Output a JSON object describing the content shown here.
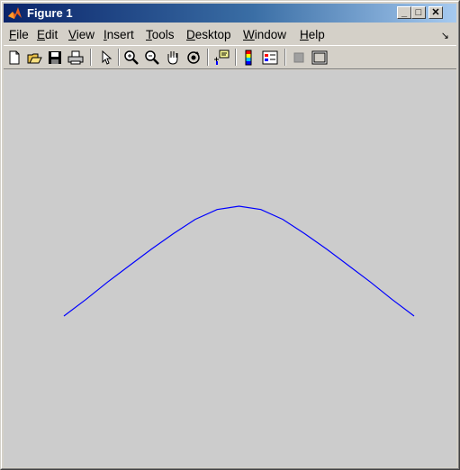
{
  "window": {
    "title": "Figure 1",
    "controls": {
      "minimize": "_",
      "maximize": "□",
      "close": "✕"
    }
  },
  "menu": {
    "items": [
      {
        "label": "File",
        "key": "F",
        "rest": "ile"
      },
      {
        "label": "Edit",
        "key": "E",
        "rest": "dit"
      },
      {
        "label": "View",
        "key": "V",
        "rest": "iew"
      },
      {
        "label": "Insert",
        "key": "I",
        "rest": "nsert"
      },
      {
        "label": "Tools",
        "key": "T",
        "rest": "ools"
      },
      {
        "label": "Desktop",
        "key": "D",
        "rest": "esktop"
      },
      {
        "label": "Window",
        "key": "W",
        "rest": "indow"
      },
      {
        "label": "Help",
        "key": "H",
        "rest": "elp"
      }
    ],
    "dock_arrow": "↘"
  },
  "toolbar": {
    "icons": [
      "new-figure-icon",
      "open-file-icon",
      "save-icon",
      "print-icon",
      "edit-plot-arrow-icon",
      "zoom-in-icon",
      "zoom-out-icon",
      "pan-hand-icon",
      "rotate-3d-icon",
      "data-cursor-icon",
      "colorbar-icon",
      "legend-icon",
      "hide-plot-tools-icon",
      "show-plot-tools-icon"
    ]
  },
  "colors": {
    "curve": "#0000ff",
    "background": "#cccccc",
    "title_start": "#0a246a",
    "title_end": "#a6caf0"
  },
  "chart_data": {
    "type": "line",
    "title": "",
    "xlabel": "",
    "ylabel": "",
    "axes_visible": false,
    "grid": false,
    "series": [
      {
        "x": [
          0,
          0.0625,
          0.125,
          0.1875,
          0.25,
          0.3125,
          0.375,
          0.4375,
          0.5,
          0.5625,
          0.625,
          0.6875,
          0.75,
          0.8125,
          0.875,
          0.9375,
          1
        ],
        "y": [
          0,
          0.15,
          0.31,
          0.46,
          0.61,
          0.75,
          0.88,
          0.97,
          1,
          0.97,
          0.88,
          0.75,
          0.61,
          0.46,
          0.31,
          0.15,
          0
        ]
      }
    ],
    "xlim": [
      0,
      1
    ],
    "ylim": [
      0,
      1
    ]
  }
}
